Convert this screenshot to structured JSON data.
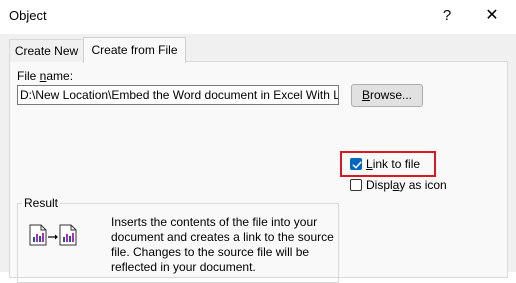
{
  "window": {
    "title": "Object",
    "help_glyph": "?",
    "close_glyph": "✕"
  },
  "tabs": [
    {
      "label": "Create New",
      "selected": false
    },
    {
      "label": "Create from File",
      "selected": true
    }
  ],
  "file": {
    "label_prefix": "File ",
    "label_access": "n",
    "label_suffix": "ame:",
    "value": "D:\\New Location\\Embed the Word document in Excel With Lin",
    "browse_access": "B",
    "browse_rest": "rowse..."
  },
  "options": {
    "link_access": "L",
    "link_rest": "ink to file",
    "link_checked": true,
    "icon_pre": "Displ",
    "icon_access": "a",
    "icon_rest": "y as icon",
    "icon_checked": false
  },
  "result": {
    "label": "Result",
    "text": "Inserts the contents of the file into your document and creates a link to the source file. Changes to the source file will be reflected in your document."
  },
  "colors": {
    "accent": "#0067c0",
    "highlight": "#d81a23"
  }
}
